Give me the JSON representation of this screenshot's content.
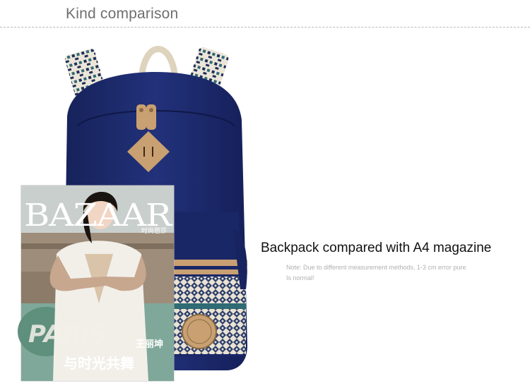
{
  "section": {
    "title": "Kind comparison"
  },
  "comparison": {
    "caption": "Backpack compared with A4 magazine",
    "note_line1": "Note: Due to different measurement methods, 1-3 cm error pure",
    "note_line2": "Is normal!"
  },
  "magazine": {
    "brand": "BAZAAR",
    "subtitle": "时尚芭莎",
    "cover_word": "PARIS",
    "cover_line": "与时光共舞",
    "cover_side": "王丽坤"
  },
  "colors": {
    "backpack_navy": "#1c2a6e",
    "leather_tan": "#c9a071",
    "text_gray": "#6f6f6f"
  }
}
